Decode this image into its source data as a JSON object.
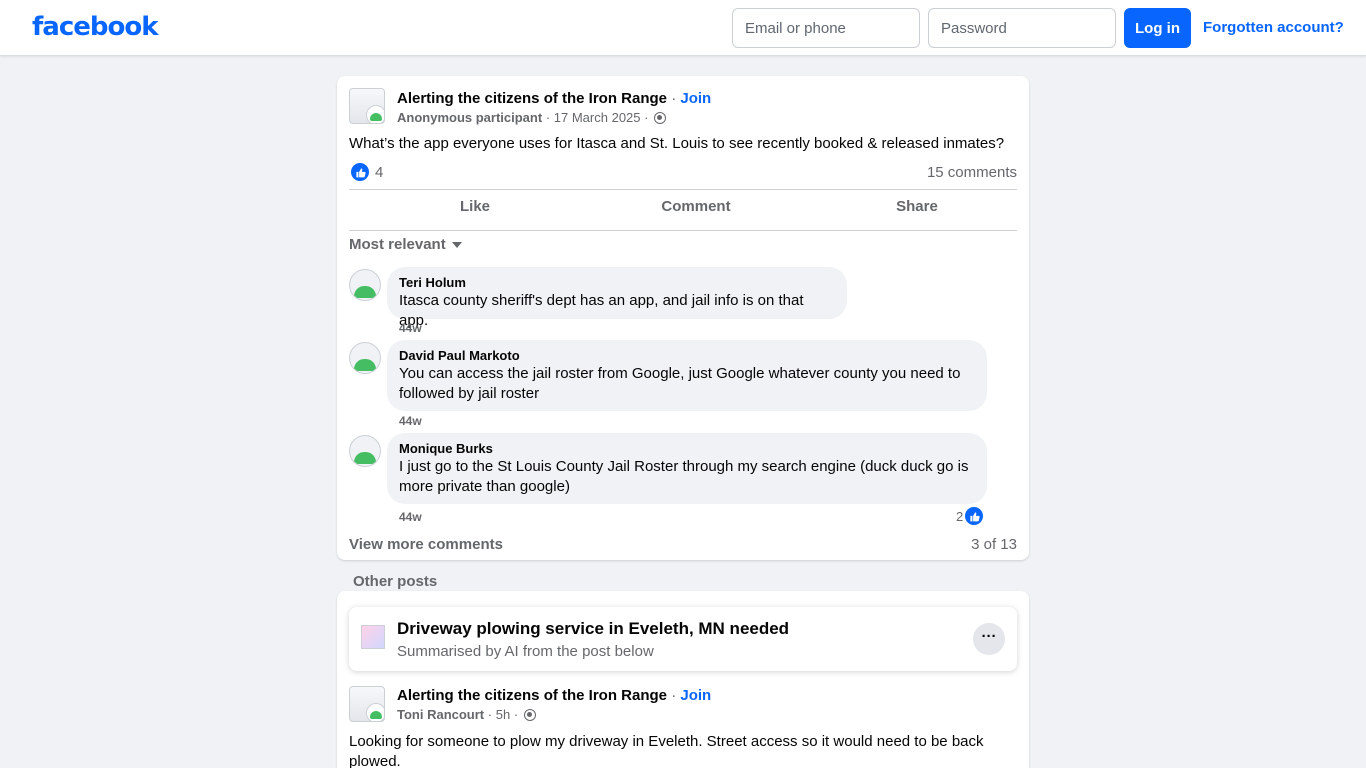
{
  "header": {
    "logo": "facebook",
    "email_placeholder": "Email or phone",
    "password_placeholder": "Password",
    "login_label": "Log in",
    "forgot_label": "Forgotten account?"
  },
  "post": {
    "group": "Alerting the citizens of the Iron Range",
    "separator": "·",
    "join": "Join",
    "author": "Anonymous participant",
    "date": "17 March 2025",
    "text": "What’s the app everyone uses for Itasca and St. Louis to see recently booked & released inmates?",
    "reaction_count": "4",
    "comments_count": "15 comments",
    "actions": {
      "like": "Like",
      "comment": "Comment",
      "share": "Share"
    },
    "sort_label": "Most relevant",
    "comments": [
      {
        "author": "Teri Holum",
        "text": "Itasca county sheriff's dept has an app, and jail info is on that app.",
        "time": "44w"
      },
      {
        "author": "David Paul Markoto",
        "text": "You can access the jail roster from Google, just Google whatever county you need to followed by jail roster",
        "time": "44w"
      },
      {
        "author": "Monique Burks",
        "text": "I just go to the St Louis County Jail Roster through my search engine (duck duck go is more private than google)",
        "time": "44w",
        "reactions": "2"
      }
    ],
    "view_more": "View more comments",
    "pager": "3 of 13"
  },
  "other_posts": {
    "label": "Other posts",
    "ai_title": "Driveway plowing service in Eveleth, MN needed",
    "ai_subtitle": "Summarised by AI from the post below",
    "more": "···",
    "group": "Alerting the citizens of the Iron Range",
    "join": "Join",
    "author": "Toni Rancourt",
    "time": "5h",
    "text": "Looking for someone to plow my driveway in Eveleth.  Street access so it would need to be back plowed."
  }
}
